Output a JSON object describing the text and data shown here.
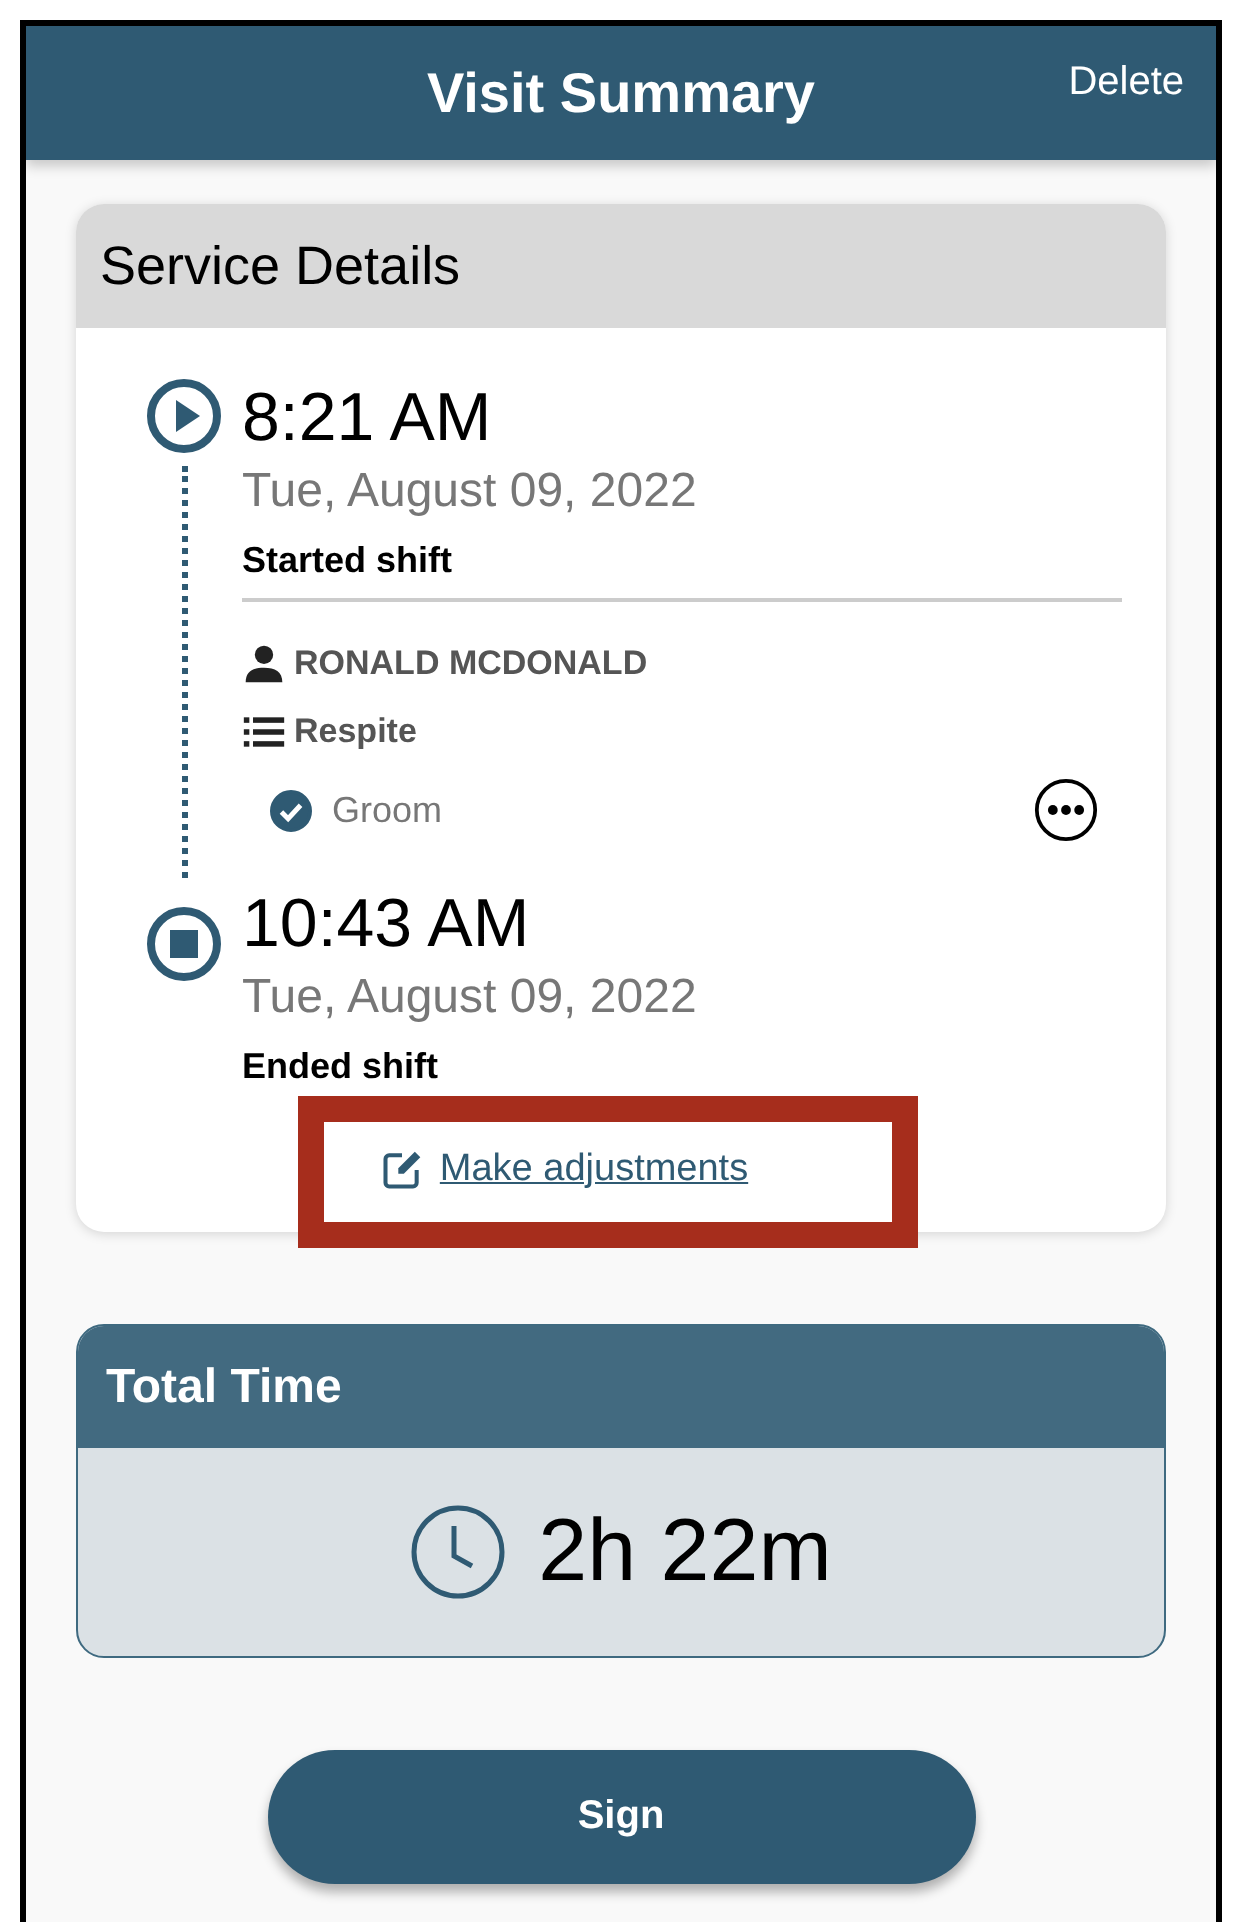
{
  "header": {
    "title": "Visit Summary",
    "action": "Delete"
  },
  "service_details": {
    "title": "Service Details",
    "events": [
      {
        "kind": "start",
        "time": "8:21 AM",
        "date": "Tue, August 09, 2022",
        "label": "Started shift"
      },
      {
        "kind": "end",
        "time": "10:43 AM",
        "date": "Tue, August 09, 2022",
        "label": "Ended shift"
      }
    ],
    "client": "RONALD MCDONALD",
    "service": "Respite",
    "tasks": [
      {
        "label": "Groom",
        "checked": true
      }
    ],
    "link": "Make adjustments"
  },
  "total_time": {
    "title": "Total Time",
    "value": "2h 22m"
  },
  "sign_button": "Sign"
}
